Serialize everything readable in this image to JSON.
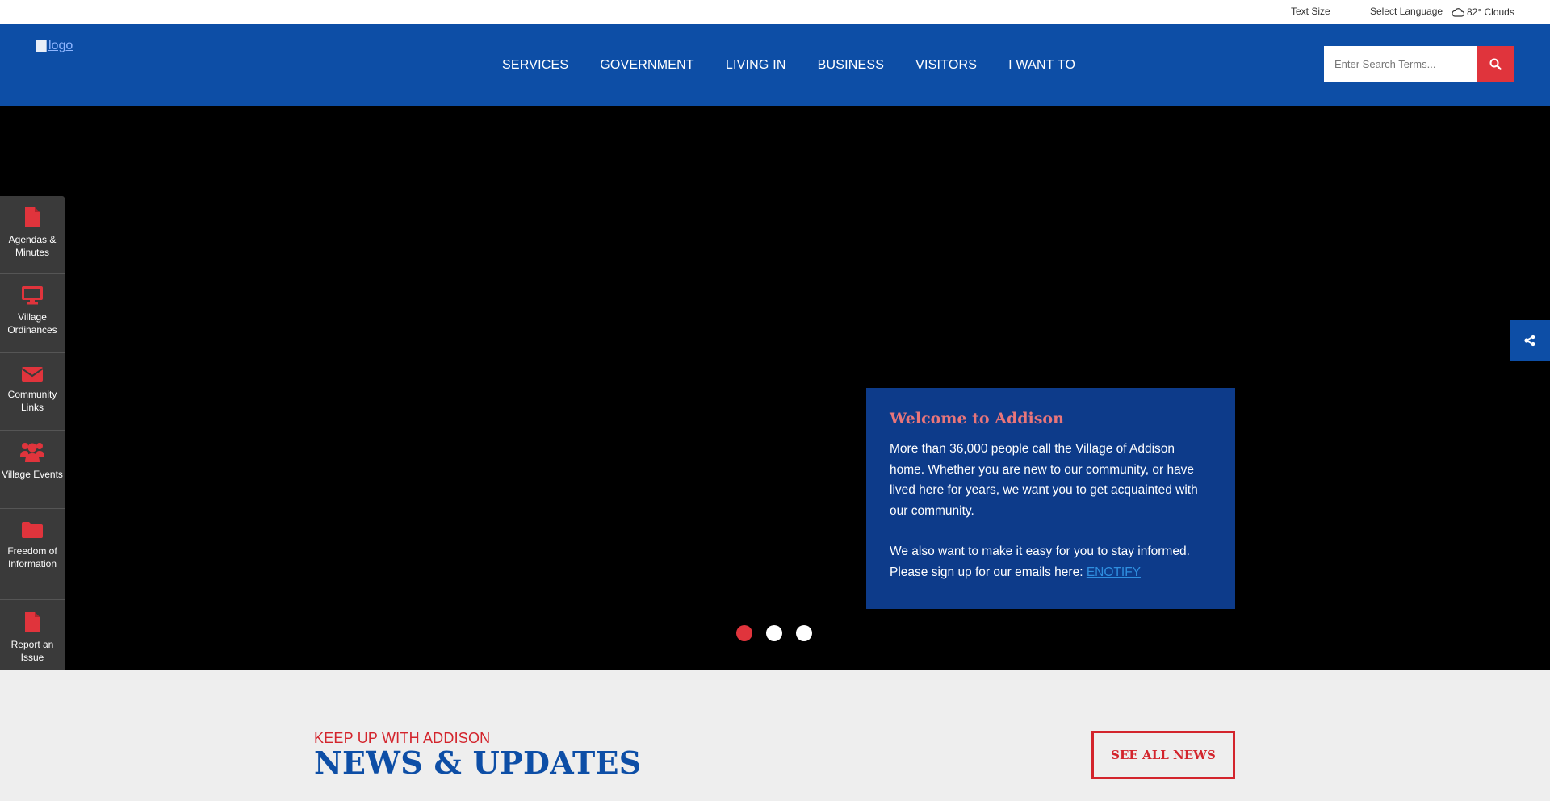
{
  "utility": {
    "text_size": "Text Size",
    "language": "Select Language",
    "weather": "82° Clouds"
  },
  "header": {
    "logo_alt": "logo",
    "nav": [
      "SERVICES",
      "GOVERNMENT",
      "LIVING IN",
      "BUSINESS",
      "VISITORS",
      "I WANT TO"
    ],
    "search_placeholder": "Enter Search Terms..."
  },
  "sidebar": [
    {
      "label": "Agendas & Minutes",
      "icon": "file-icon"
    },
    {
      "label": "Village Ordinances",
      "icon": "desktop-icon"
    },
    {
      "label": "Community Links",
      "icon": "envelope-icon"
    },
    {
      "label": "Village Events",
      "icon": "users-icon"
    },
    {
      "label": "Freedom of Information",
      "icon": "folder-icon"
    },
    {
      "label": "Report an Issue",
      "icon": "file-icon"
    }
  ],
  "hero": {
    "welcome_title": "Welcome to Addison",
    "welcome_p1": "More than 36,000 people call the Village of Addison home.  Whether you are new to our community, or have lived here for years, we want you to get acquainted with our community.",
    "welcome_p2": "We also want to make it easy for you to stay informed. Please sign up for our emails here:  ",
    "welcome_link": "ENOTIFY",
    "slides_total": 3,
    "slide_active": 1
  },
  "news": {
    "kicker": "KEEP UP WITH ADDISON",
    "title": "NEWS & UPDATES",
    "see_all": "SEE ALL NEWS"
  },
  "colors": {
    "brand_blue": "#0d4ea6",
    "panel_blue": "#0d3b8a",
    "accent_red": "#e0343c",
    "sidebar_gray": "#3a3a3a"
  }
}
